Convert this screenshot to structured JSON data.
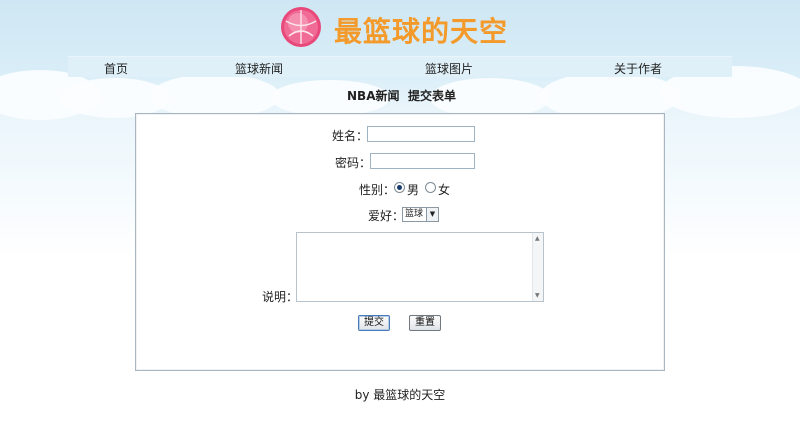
{
  "header": {
    "title": "最篮球的天空",
    "logo_icon": "basketball-icon"
  },
  "nav": {
    "items": [
      "首页",
      "篮球新闻",
      "篮球图片",
      "关于作者"
    ]
  },
  "subheading": {
    "link1": "NBA新闻",
    "link2": "提交表单"
  },
  "form": {
    "name_label": "姓名：",
    "name_value": "",
    "password_label": "密码：",
    "password_value": "",
    "gender_label": "性别：",
    "gender_male": "男",
    "gender_female": "女",
    "gender_selected": "男",
    "hobby_label": "爱好：",
    "hobby_selected": "篮球",
    "description_label": "说明：",
    "description_value": "",
    "submit_label": "提交",
    "reset_label": "重置"
  },
  "footer": {
    "text": "by 最篮球的天空"
  },
  "colors": {
    "title": "#f39a2b",
    "logo": "#e8487a",
    "nav_bg": "#dff0f8",
    "sky": "#cfe7f4"
  }
}
